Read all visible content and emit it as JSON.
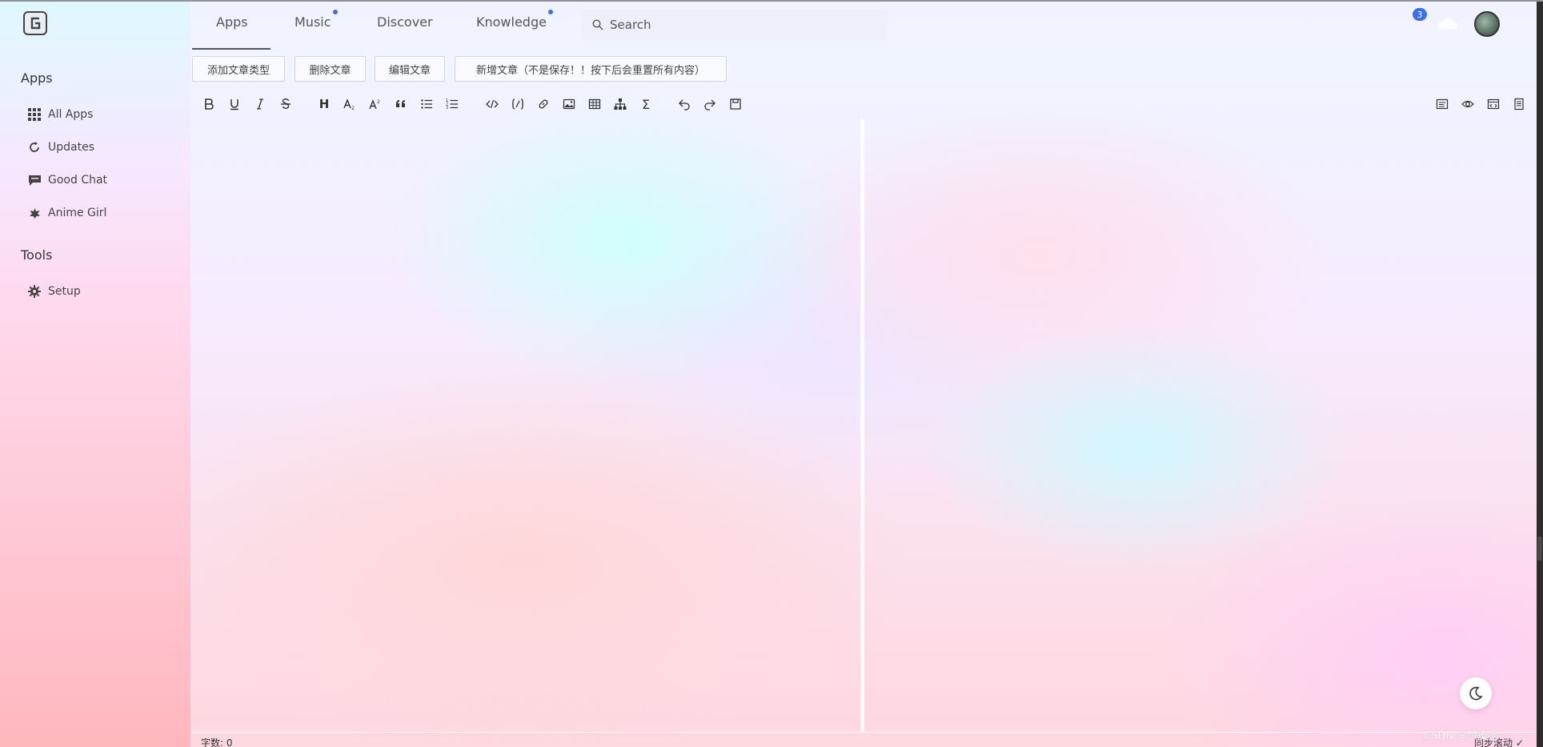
{
  "sidebar": {
    "apps_heading": "Apps",
    "tools_heading": "Tools",
    "items": [
      {
        "label": "All Apps",
        "icon": "grid-icon"
      },
      {
        "label": "Updates",
        "icon": "refresh-icon"
      },
      {
        "label": "Good Chat",
        "icon": "chat-icon"
      },
      {
        "label": "Anime Girl",
        "icon": "leaf-icon"
      }
    ],
    "tools": [
      {
        "label": "Setup",
        "icon": "gear-icon"
      }
    ]
  },
  "nav": {
    "tabs": [
      {
        "label": "Apps",
        "active": true,
        "dot": false
      },
      {
        "label": "Music",
        "active": false,
        "dot": true
      },
      {
        "label": "Discover",
        "active": false,
        "dot": false
      },
      {
        "label": "Knowledge",
        "active": false,
        "dot": true
      }
    ],
    "search_placeholder": "Search",
    "notification_count": "3",
    "accent": "#3b6fe6"
  },
  "actions": {
    "add_type": "添加文章类型",
    "delete": "删除文章",
    "edit": "编辑文章",
    "new": "新增文章（不是保存！！按下后会重置所有内容）"
  },
  "toolbar": {
    "heading_glyph": "H",
    "sum_glyph": "Σ"
  },
  "editor": {
    "word_count": "字数: 0",
    "sync_scroll": "同步滚动 ✓",
    "watermark": "CSDN @顽皮宝"
  }
}
